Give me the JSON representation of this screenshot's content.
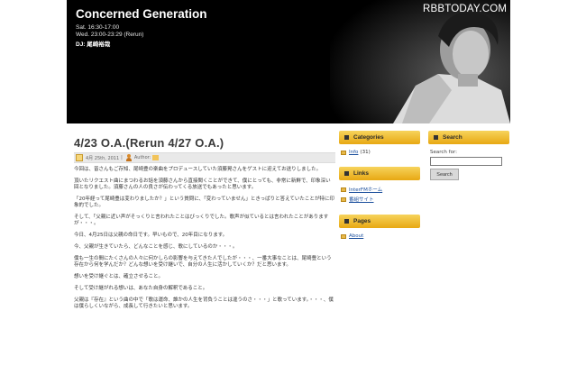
{
  "header": {
    "title": "Concerned Generation",
    "schedule_line1": "Sat. 16:30-17:00",
    "schedule_line2": "Wed. 23:00-23:29 (Rerun)",
    "dj_line": "DJ: 尾崎裕哉",
    "watermark": "RBBTODAY.COM"
  },
  "post": {
    "title": "4/23 O.A.(Rerun 4/27 O.A.)",
    "date": "4月 25th, 2011",
    "author_label": "Author:",
    "paragraphs": [
      "今回は、皆さんもご存知、尾崎豊の楽曲をプロデュースしていた須藤晃さんをゲストに迎えてお送りしました。",
      "頂いたリクエスト曲にまつわるお話を須藤さんから直接聞くことができて、僕にとっても、非常に新鮮で、印象深い回となりました。須藤さんの人の良さが伝わってくる放送でもあったと思います。",
      "「20年経って尾崎豊は変わりましたか？」という質問に、「変わっていません」ときっぱりと答えていたことが特に印象的でした。",
      "そして、「父親に近い声がそっくりと言われたことはびっくりでした。歌声が似ているとは言われたことがありますが・・・。",
      "今日、4月25日は父親の命日です。早いもので、20年目になります。",
      "今、父親が生きていたら、どんなことを感じ、歌にしているのか・・・。",
      "僕も一生の間にたくさんの人々に何かしらの影響を与えてきた人でしたが・・・、一番大事なことは、尾崎豊という存在から何を学んだか？どんな想いを受け継いで、自分の人生に活かしていくか？だと思います。",
      "想いを受け継ぐとは、確立させること。",
      "そして受け継がれる想いは、あなた自身の解釈であること。",
      "父親は『存在』という曲の中で「歌は運命、誰かの人生を背負うことは違うのさ・・・」と歌っています。・・・、僕は僕らしくいながら、成長して行きたいと思います。"
    ]
  },
  "widgets": {
    "categories": {
      "title": "Categories",
      "items": [
        {
          "label": "Info",
          "count": "(31)"
        }
      ]
    },
    "links": {
      "title": "Links",
      "items": [
        {
          "label": "InterFMホーム"
        },
        {
          "label": "番組サイト"
        }
      ]
    },
    "pages": {
      "title": "Pages",
      "items": [
        {
          "label": "About"
        }
      ]
    },
    "search": {
      "title": "Search",
      "label": "Search for:",
      "button": "Search"
    }
  },
  "colors": {
    "widget_title_top": "#f7d35c",
    "widget_title_bottom": "#e8a813",
    "link": "#1a4e9c",
    "header_bg": "#000000"
  }
}
